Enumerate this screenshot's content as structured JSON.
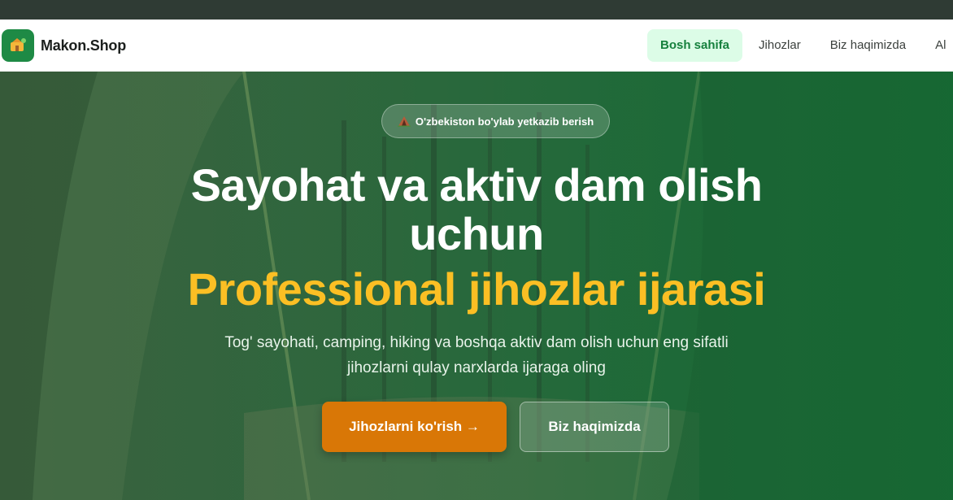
{
  "header": {
    "brand_name": "Makon.Shop",
    "nav": [
      {
        "label": "Bosh sahifa",
        "active": true
      },
      {
        "label": "Jihozlar",
        "active": false
      },
      {
        "label": "Biz haqimizda",
        "active": false
      },
      {
        "label": "Al",
        "active": false
      }
    ]
  },
  "hero": {
    "badge_icon": "tent-icon",
    "badge_text": "O'zbekiston bo'ylab yetkazib berish",
    "title_line1": "Sayohat va aktiv dam olish",
    "title_line2": "uchun",
    "title_highlight": "Professional jihozlar ijarasi",
    "subtitle": "Tog' sayohati, camping, hiking va boshqa aktiv dam olish uchun eng sifatli jihozlarni qulay narxlarda ijaraga oling",
    "primary_button": "Jihozlarni ko'rish →",
    "secondary_button": "Biz haqimizda"
  },
  "colors": {
    "brand_green": "#1e8a45",
    "active_nav_bg": "#dcfce7",
    "highlight_yellow": "#fbbf24",
    "primary_button": "#d97706"
  }
}
